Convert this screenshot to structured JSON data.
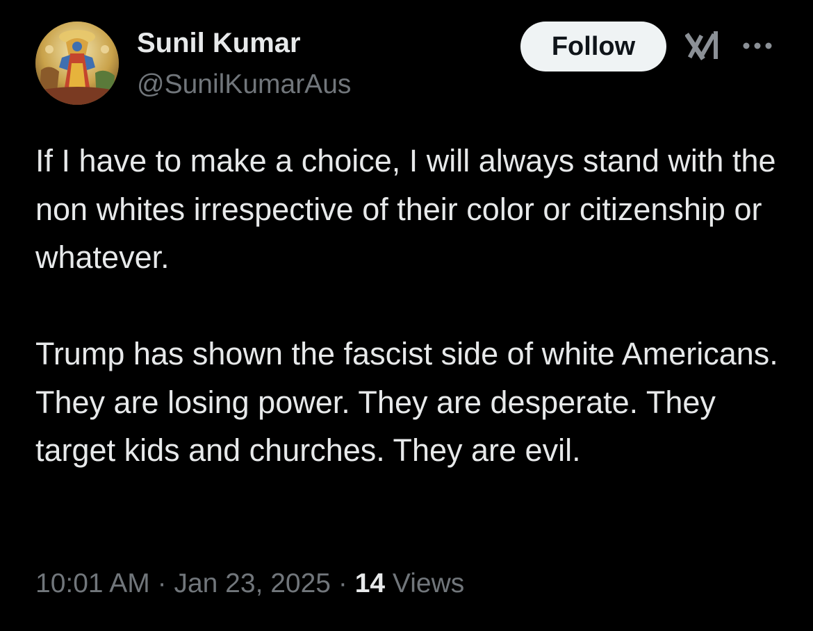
{
  "author": {
    "name": "Sunil Kumar",
    "handle": "@SunilKumarAus"
  },
  "actions": {
    "follow_label": "Follow",
    "grok_icon": "grok-icon",
    "more_icon": "more-icon"
  },
  "tweet": {
    "paragraphs": [
      "If I have to make a choice, I will always stand with the non whites irrespective of their color or citizenship or whatever.",
      "Trump has shown the fascist side of white Americans. They are losing power. They are desperate. They target kids and churches. They are evil."
    ]
  },
  "meta": {
    "time": "10:01 AM",
    "separator": "·",
    "date": "Jan 23, 2025",
    "views_count": "14",
    "views_label": "Views"
  },
  "colors": {
    "background": "#000000",
    "primary_text": "#e7e9ea",
    "secondary_text": "#71767b",
    "follow_button_bg": "#eff3f4",
    "follow_button_text": "#0f1419"
  }
}
